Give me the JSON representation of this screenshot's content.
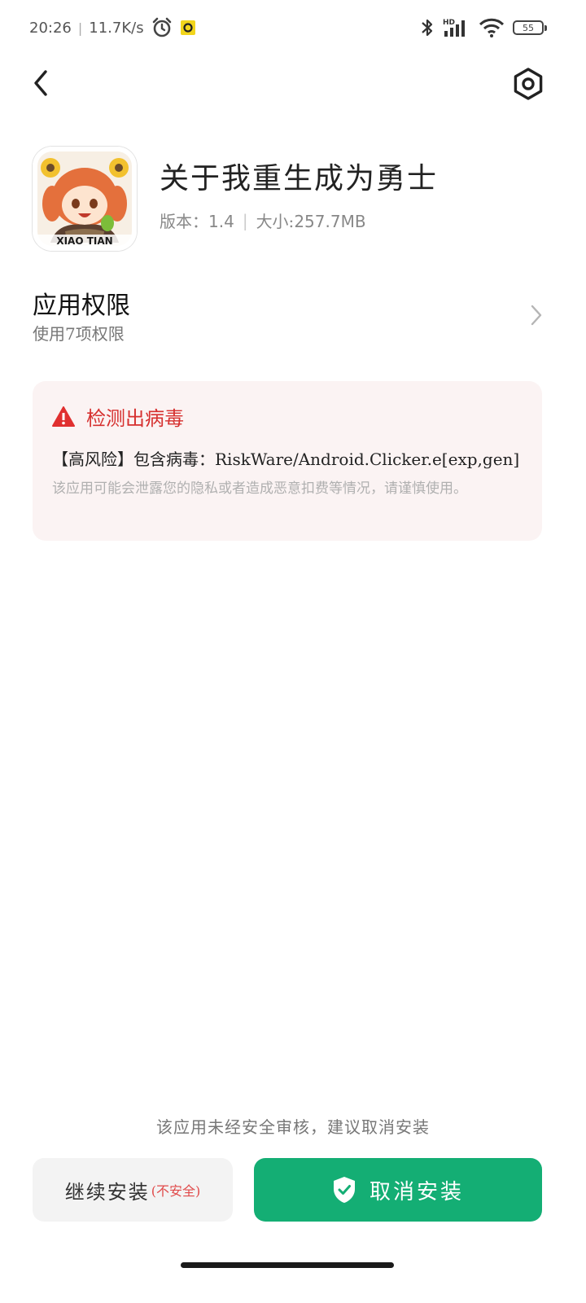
{
  "status_bar": {
    "time": "20:26",
    "net_speed": "11.7K/s",
    "battery_level": "55",
    "icons": [
      "alarm-icon",
      "app-notification-icon",
      "bluetooth-icon",
      "hd-signal-icon",
      "wifi-icon",
      "battery-icon"
    ]
  },
  "nav": {
    "back_icon": "chevron-left-icon",
    "settings_icon": "gear-icon"
  },
  "app": {
    "name": "关于我重生成为勇士",
    "version_label": "版本：",
    "version": "1.4",
    "size_label": "大小:",
    "size": "257.7MB",
    "icon_text": "XIAO TIAN"
  },
  "permissions": {
    "title": "应用权限",
    "subtitle": "使用7项权限"
  },
  "virus_card": {
    "title": "检测出病毒",
    "detail": "【高风险】包含病毒：RiskWare/Android.Clicker.e[exp,gen]",
    "note": "该应用可能会泄露您的隐私或者造成恶意扣费等情况，请谨慎使用。",
    "accent": "#d6302f"
  },
  "bottom": {
    "note": "该应用未经安全审核，建议取消安装",
    "continue_label": "继续安装",
    "continue_warning": "(不安全)",
    "cancel_label": "取消安装",
    "cancel_color": "#14ae74"
  }
}
